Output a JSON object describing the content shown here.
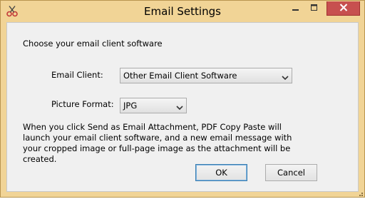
{
  "window": {
    "title": "Email Settings",
    "colors": {
      "frame": "#f1d496",
      "close": "#c7504f",
      "client": "#f0f0f0"
    }
  },
  "dialog": {
    "intro": "Choose your email client software",
    "email_client": {
      "label": "Email Client:",
      "selected": "Other Email Client Software"
    },
    "picture_format": {
      "label": "Picture Format:",
      "selected": "JPG"
    },
    "description": "When you click Send as Email Attachment, PDF Copy Paste will launch your email client software, and a new email message with your cropped image or full-page image as the attachment will be created.",
    "buttons": {
      "ok": "OK",
      "cancel": "Cancel"
    }
  },
  "icons": {
    "app": "scissors-icon",
    "minimize": "minimize-icon",
    "maximize": "maximize-icon",
    "close": "close-icon",
    "dropdown": "chevron-down-icon"
  }
}
